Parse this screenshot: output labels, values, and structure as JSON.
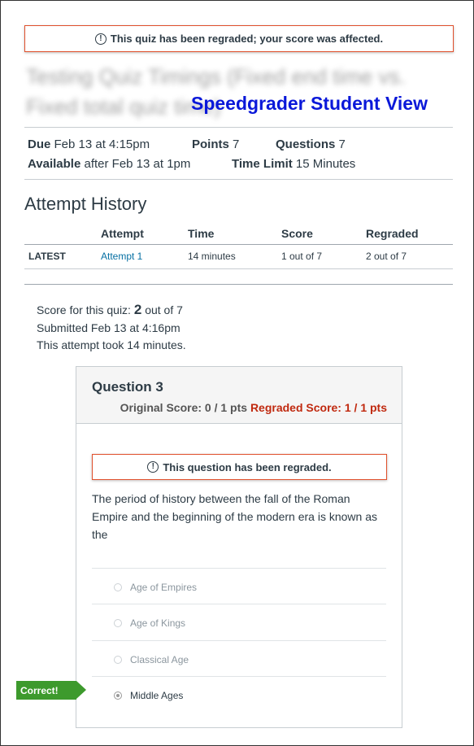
{
  "banner": {
    "icon": "!",
    "text": "This quiz has been regraded; your score was affected."
  },
  "quiz_title": "Testing Quiz Timings (Fixed end time vs. Fixed total quiz time)",
  "overlay_label": "Speedgrader Student View",
  "details": {
    "due_label": "Due",
    "due_value": "Feb 13 at 4:15pm",
    "points_label": "Points",
    "points_value": "7",
    "questions_label": "Questions",
    "questions_value": "7",
    "available_label": "Available",
    "available_value": "after Feb 13 at 1pm",
    "time_limit_label": "Time Limit",
    "time_limit_value": "15 Minutes"
  },
  "attempt_history": {
    "heading": "Attempt History",
    "columns": [
      "Attempt",
      "Time",
      "Score",
      "Regraded"
    ],
    "rows": [
      {
        "label": "LATEST",
        "attempt": "Attempt 1",
        "time": "14 minutes",
        "score": "1 out of 7",
        "regraded": "2 out of 7"
      }
    ]
  },
  "summary": {
    "score_prefix": "Score for this quiz:",
    "score_value": "2",
    "score_suffix": "out of 7",
    "submitted": "Submitted Feb 13 at 4:16pm",
    "duration": "This attempt took 14 minutes."
  },
  "question": {
    "title": "Question 3",
    "original_score": "Original Score: 0 / 1 pts",
    "regraded_score": "Regraded Score: 1 / 1 pts",
    "alert_icon": "!",
    "alert_text": "This question has been regraded.",
    "text": "The period of history between the fall of the Roman Empire and the beginning of the modern era is known as the",
    "options": [
      "Age of Empires",
      "Age of Kings",
      "Classical Age",
      "Middle Ages"
    ],
    "selected_index": 3,
    "correct_tag": "Correct!"
  },
  "colors": {
    "alert_border": "#e0502c",
    "regraded": "#c0290f",
    "link": "#0770a3",
    "correct": "#3d9a2d",
    "overlay": "#0a18d9"
  }
}
